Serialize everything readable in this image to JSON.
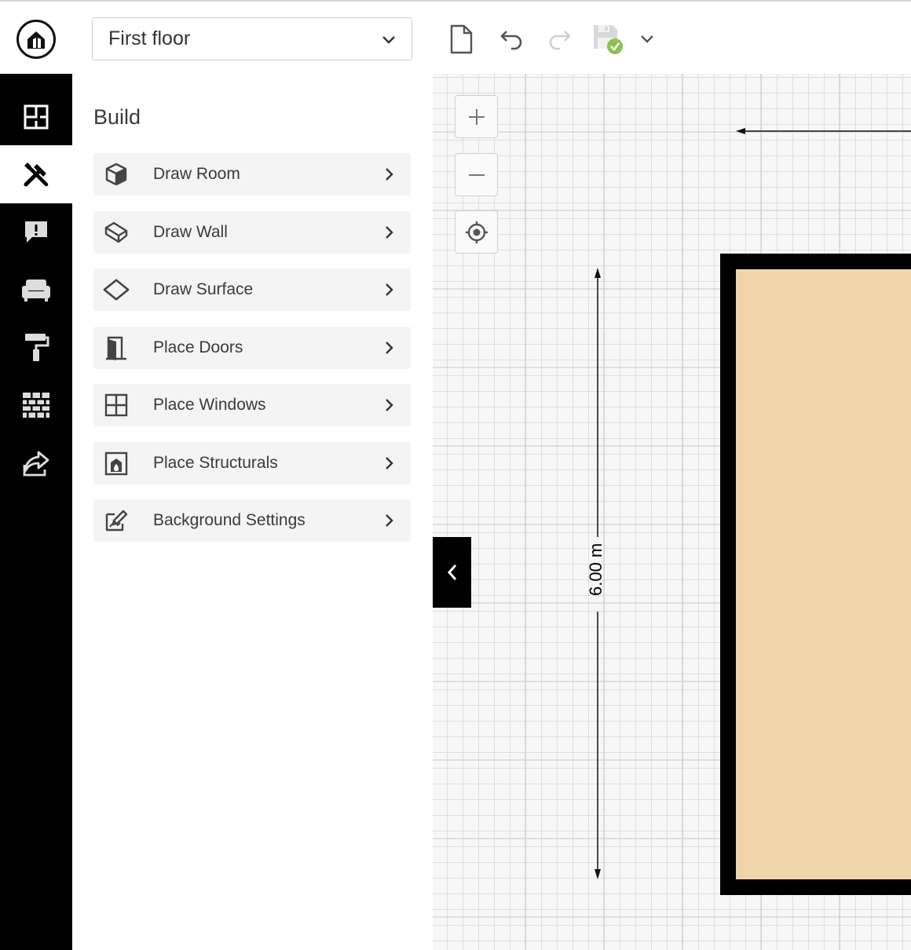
{
  "header": {
    "logo_icon": "house-logo-icon",
    "floor_select": {
      "value": "First floor",
      "icon": "chevron-down-icon"
    },
    "toolbar": [
      {
        "name": "new-document-button",
        "icon": "document-icon"
      },
      {
        "name": "undo-button",
        "icon": "undo-icon"
      },
      {
        "name": "redo-button",
        "icon": "redo-icon",
        "disabled": true
      },
      {
        "name": "save-button",
        "icon": "save-icon",
        "status": "saved"
      },
      {
        "name": "more-dropdown-button",
        "icon": "chevron-down-icon"
      }
    ]
  },
  "sidebar": {
    "items": [
      {
        "name": "floorplan",
        "icon": "floorplan-icon"
      },
      {
        "name": "build",
        "icon": "build-tools-icon",
        "active": true
      },
      {
        "name": "info",
        "icon": "info-bubble-icon"
      },
      {
        "name": "furniture",
        "icon": "sofa-icon"
      },
      {
        "name": "paint",
        "icon": "paint-roller-icon"
      },
      {
        "name": "materials",
        "icon": "brick-wall-icon"
      },
      {
        "name": "share",
        "icon": "share-icon"
      }
    ]
  },
  "panel": {
    "title": "Build",
    "items": [
      {
        "label": "Draw Room",
        "icon": "cube-icon"
      },
      {
        "label": "Draw Wall",
        "icon": "wall-icon"
      },
      {
        "label": "Draw Surface",
        "icon": "surface-diamond-icon"
      },
      {
        "label": "Place Doors",
        "icon": "door-icon"
      },
      {
        "label": "Place Windows",
        "icon": "window-icon"
      },
      {
        "label": "Place Structurals",
        "icon": "fireplace-icon"
      },
      {
        "label": "Background Settings",
        "icon": "edit-image-icon"
      }
    ]
  },
  "canvas": {
    "zoom_in_icon": "plus-icon",
    "zoom_out_icon": "minus-icon",
    "center_icon": "crosshair-icon",
    "collapse_icon": "chevron-left-icon",
    "dimension_label": "6.00 m",
    "colors": {
      "room_fill": "#f0d5aa",
      "wall": "#000000",
      "grid": "#dedede"
    }
  }
}
